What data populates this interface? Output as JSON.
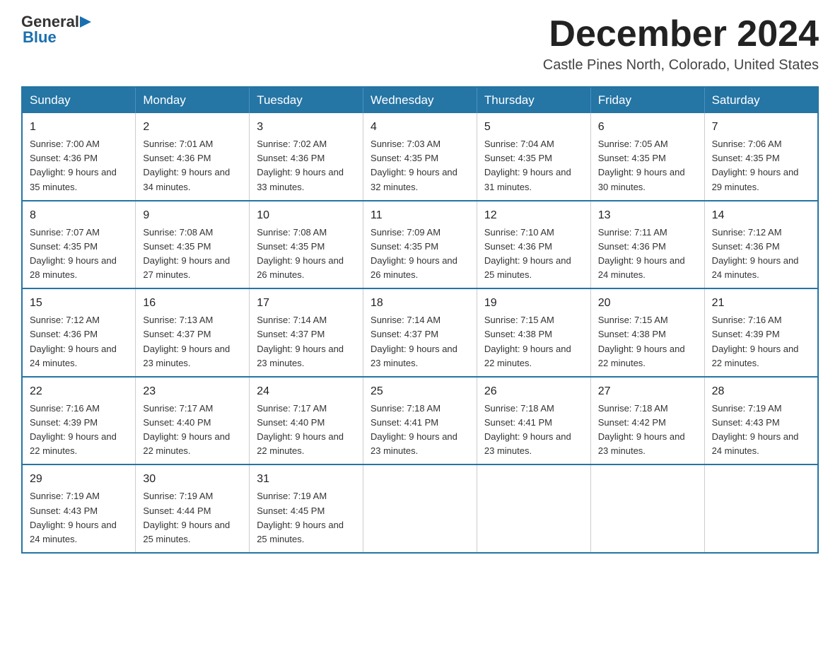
{
  "header": {
    "logo": {
      "general": "General",
      "blue": "Blue",
      "triangle": "▶"
    },
    "month_year": "December 2024",
    "location": "Castle Pines North, Colorado, United States"
  },
  "calendar": {
    "days_of_week": [
      "Sunday",
      "Monday",
      "Tuesday",
      "Wednesday",
      "Thursday",
      "Friday",
      "Saturday"
    ],
    "weeks": [
      [
        {
          "day": "1",
          "sunrise": "7:00 AM",
          "sunset": "4:36 PM",
          "daylight": "9 hours and 35 minutes."
        },
        {
          "day": "2",
          "sunrise": "7:01 AM",
          "sunset": "4:36 PM",
          "daylight": "9 hours and 34 minutes."
        },
        {
          "day": "3",
          "sunrise": "7:02 AM",
          "sunset": "4:36 PM",
          "daylight": "9 hours and 33 minutes."
        },
        {
          "day": "4",
          "sunrise": "7:03 AM",
          "sunset": "4:35 PM",
          "daylight": "9 hours and 32 minutes."
        },
        {
          "day": "5",
          "sunrise": "7:04 AM",
          "sunset": "4:35 PM",
          "daylight": "9 hours and 31 minutes."
        },
        {
          "day": "6",
          "sunrise": "7:05 AM",
          "sunset": "4:35 PM",
          "daylight": "9 hours and 30 minutes."
        },
        {
          "day": "7",
          "sunrise": "7:06 AM",
          "sunset": "4:35 PM",
          "daylight": "9 hours and 29 minutes."
        }
      ],
      [
        {
          "day": "8",
          "sunrise": "7:07 AM",
          "sunset": "4:35 PM",
          "daylight": "9 hours and 28 minutes."
        },
        {
          "day": "9",
          "sunrise": "7:08 AM",
          "sunset": "4:35 PM",
          "daylight": "9 hours and 27 minutes."
        },
        {
          "day": "10",
          "sunrise": "7:08 AM",
          "sunset": "4:35 PM",
          "daylight": "9 hours and 26 minutes."
        },
        {
          "day": "11",
          "sunrise": "7:09 AM",
          "sunset": "4:35 PM",
          "daylight": "9 hours and 26 minutes."
        },
        {
          "day": "12",
          "sunrise": "7:10 AM",
          "sunset": "4:36 PM",
          "daylight": "9 hours and 25 minutes."
        },
        {
          "day": "13",
          "sunrise": "7:11 AM",
          "sunset": "4:36 PM",
          "daylight": "9 hours and 24 minutes."
        },
        {
          "day": "14",
          "sunrise": "7:12 AM",
          "sunset": "4:36 PM",
          "daylight": "9 hours and 24 minutes."
        }
      ],
      [
        {
          "day": "15",
          "sunrise": "7:12 AM",
          "sunset": "4:36 PM",
          "daylight": "9 hours and 24 minutes."
        },
        {
          "day": "16",
          "sunrise": "7:13 AM",
          "sunset": "4:37 PM",
          "daylight": "9 hours and 23 minutes."
        },
        {
          "day": "17",
          "sunrise": "7:14 AM",
          "sunset": "4:37 PM",
          "daylight": "9 hours and 23 minutes."
        },
        {
          "day": "18",
          "sunrise": "7:14 AM",
          "sunset": "4:37 PM",
          "daylight": "9 hours and 23 minutes."
        },
        {
          "day": "19",
          "sunrise": "7:15 AM",
          "sunset": "4:38 PM",
          "daylight": "9 hours and 22 minutes."
        },
        {
          "day": "20",
          "sunrise": "7:15 AM",
          "sunset": "4:38 PM",
          "daylight": "9 hours and 22 minutes."
        },
        {
          "day": "21",
          "sunrise": "7:16 AM",
          "sunset": "4:39 PM",
          "daylight": "9 hours and 22 minutes."
        }
      ],
      [
        {
          "day": "22",
          "sunrise": "7:16 AM",
          "sunset": "4:39 PM",
          "daylight": "9 hours and 22 minutes."
        },
        {
          "day": "23",
          "sunrise": "7:17 AM",
          "sunset": "4:40 PM",
          "daylight": "9 hours and 22 minutes."
        },
        {
          "day": "24",
          "sunrise": "7:17 AM",
          "sunset": "4:40 PM",
          "daylight": "9 hours and 22 minutes."
        },
        {
          "day": "25",
          "sunrise": "7:18 AM",
          "sunset": "4:41 PM",
          "daylight": "9 hours and 23 minutes."
        },
        {
          "day": "26",
          "sunrise": "7:18 AM",
          "sunset": "4:41 PM",
          "daylight": "9 hours and 23 minutes."
        },
        {
          "day": "27",
          "sunrise": "7:18 AM",
          "sunset": "4:42 PM",
          "daylight": "9 hours and 23 minutes."
        },
        {
          "day": "28",
          "sunrise": "7:19 AM",
          "sunset": "4:43 PM",
          "daylight": "9 hours and 24 minutes."
        }
      ],
      [
        {
          "day": "29",
          "sunrise": "7:19 AM",
          "sunset": "4:43 PM",
          "daylight": "9 hours and 24 minutes."
        },
        {
          "day": "30",
          "sunrise": "7:19 AM",
          "sunset": "4:44 PM",
          "daylight": "9 hours and 25 minutes."
        },
        {
          "day": "31",
          "sunrise": "7:19 AM",
          "sunset": "4:45 PM",
          "daylight": "9 hours and 25 minutes."
        },
        null,
        null,
        null,
        null
      ]
    ]
  }
}
